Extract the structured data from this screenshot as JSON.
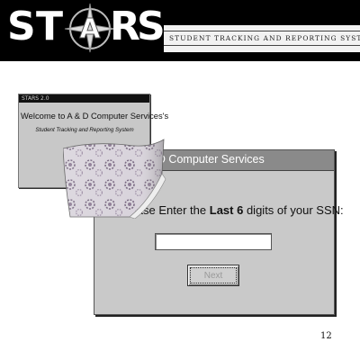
{
  "header": {
    "logo": [
      "S",
      "T",
      "A",
      "R",
      "S"
    ],
    "logo_icon": "compass-star-icon",
    "subtitle": "STUDENT TRACKING AND REPORTING SYSTEM"
  },
  "splash_window": {
    "titlebar": "STARS 2.0",
    "welcome": "Welcome to A & D Computer Services's",
    "system": "Student Tracking and Reporting System"
  },
  "dialog": {
    "title": "A & D Computer Services",
    "prompt_pre": "Please Enter the",
    "prompt_bold": "Last 6",
    "prompt_post": "digits of your SSN:",
    "ssn_value": "",
    "next_label": "Next"
  },
  "page_number": "12"
}
